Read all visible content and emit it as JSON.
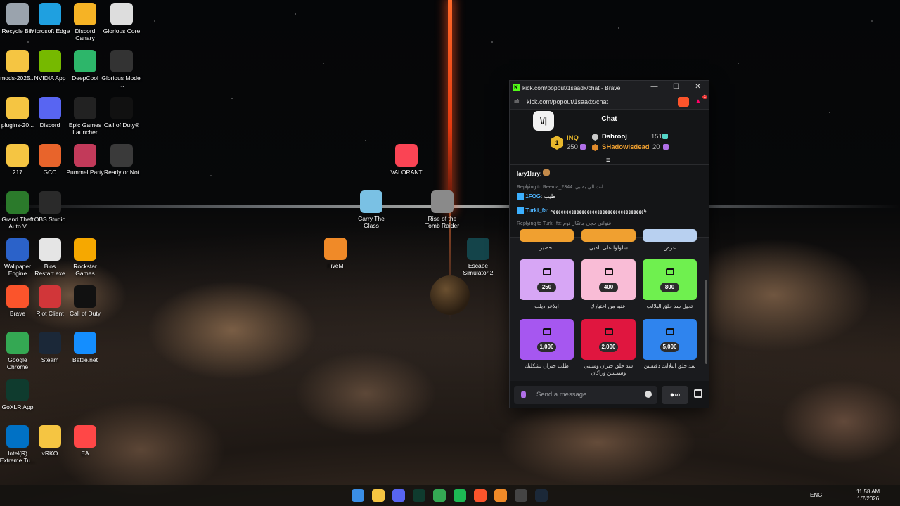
{
  "desktop_icons": [
    {
      "label": "Recycle Bin",
      "icon": "recycle-bin-icon",
      "color": "#9aa3ad"
    },
    {
      "label": "Microsoft Edge",
      "icon": "edge-icon",
      "color": "#1fa0e0"
    },
    {
      "label": "Discord Canary",
      "icon": "discord-canary-icon",
      "color": "#f6b325"
    },
    {
      "label": "Glorious Core",
      "icon": "glorious-core-icon",
      "color": "#dddddd"
    },
    {
      "label": "mods-2025...",
      "icon": "folder-icon",
      "color": "#f5c542"
    },
    {
      "label": "NVIDIA App",
      "icon": "nvidia-icon",
      "color": "#76b900"
    },
    {
      "label": "DeepCool",
      "icon": "deepcool-icon",
      "color": "#2db66a"
    },
    {
      "label": "Glorious Model ...",
      "icon": "mouse-icon",
      "color": "#333333"
    },
    {
      "label": "plugins-20...",
      "icon": "folder-icon",
      "color": "#f5c542"
    },
    {
      "label": "Discord",
      "icon": "discord-icon",
      "color": "#5865f2"
    },
    {
      "label": "Epic Games Launcher",
      "icon": "epic-games-icon",
      "color": "#222222"
    },
    {
      "label": "Call of Duty®",
      "icon": "call-of-duty-icon",
      "color": "#111111"
    },
    {
      "label": "217",
      "icon": "folder-icon",
      "color": "#f5c542"
    },
    {
      "label": "GCC",
      "icon": "gcc-icon",
      "color": "#e8642b"
    },
    {
      "label": "Pummel Party",
      "icon": "pummel-party-icon",
      "color": "#c23a5a"
    },
    {
      "label": "Ready or Not",
      "icon": "ready-or-not-icon",
      "color": "#3a3a3a"
    },
    {
      "label": "Grand Theft Auto V",
      "icon": "gta-icon",
      "color": "#2b7a2b"
    },
    {
      "label": "OBS Studio",
      "icon": "obs-icon",
      "color": "#2a2a2a"
    },
    {
      "label": "Wallpaper Engine",
      "icon": "wallpaper-engine-icon",
      "color": "#2b62c9"
    },
    {
      "label": "Bios Restart.exe",
      "icon": "bios-icon",
      "color": "#e5e5e5"
    },
    {
      "label": "Rockstar Games",
      "icon": "rockstar-icon",
      "color": "#f6a800"
    },
    {
      "label": "Brave",
      "icon": "brave-icon",
      "color": "#fb542b"
    },
    {
      "label": "Riot Client",
      "icon": "riot-icon",
      "color": "#d13639"
    },
    {
      "label": "Call of Duty",
      "icon": "call-of-duty-icon",
      "color": "#111111"
    },
    {
      "label": "Google Chrome",
      "icon": "chrome-icon",
      "color": "#34a853"
    },
    {
      "label": "Steam",
      "icon": "steam-icon",
      "color": "#1b2838"
    },
    {
      "label": "Battle.net",
      "icon": "battlenet-icon",
      "color": "#148eff"
    },
    {
      "label": "GoXLR App",
      "icon": "goxlr-icon",
      "color": "#0f3b2e"
    },
    {
      "label": "Intel(R) Extreme Tu...",
      "icon": "intel-icon",
      "color": "#0071c5"
    },
    {
      "label": "vRKO",
      "icon": "folder-icon",
      "color": "#f5c542"
    },
    {
      "label": "EA",
      "icon": "ea-icon",
      "color": "#ff4747"
    },
    {
      "label": "VALORANT",
      "icon": "valorant-icon",
      "color": "#fa4454"
    },
    {
      "label": "Carry The Glass",
      "icon": "carry-the-glass-icon",
      "color": "#7ac1e4"
    },
    {
      "label": "Rise of the Tomb Raider",
      "icon": "tomb-raider-icon",
      "color": "#8a8a8a"
    },
    {
      "label": "FiveM",
      "icon": "fivem-icon",
      "color": "#f08a28"
    },
    {
      "label": "Escape Simulator 2",
      "icon": "escape-simulator-icon",
      "color": "#14444a"
    }
  ],
  "browser": {
    "title": "kick.com/popout/1saadx/chat - Brave",
    "url": "kick.com/popout/1saadx/chat",
    "shield_badge": "",
    "notif_badge": "1"
  },
  "chat": {
    "header": "Chat",
    "badge": "\\/‾│",
    "leaderboard": {
      "first": {
        "rank": "1",
        "name": "INQ",
        "points": "250"
      },
      "second": [
        {
          "name": "Dahrooj",
          "points": "151"
        },
        {
          "name": "SHadowisdead",
          "points": "20"
        }
      ]
    },
    "messages": [
      {
        "user": "lary1lary",
        "text": "",
        "color": "#e4e4e4"
      },
      {
        "reply": "Replying to Reema_2344: انت الي بقابي"
      },
      {
        "user": "1FOG",
        "text": "طيب",
        "color": "#4fb5ff"
      },
      {
        "user": "Turki_fa",
        "text": "ههههههههههههههههههههههههههههههههههههه",
        "color": "#4fb5ff"
      },
      {
        "reply": "Replying to Turki_fa: غنواني حجي ماتكال توم"
      }
    ],
    "rewards": [
      {
        "label": "تحضير",
        "cost": "",
        "color": "#f0a030"
      },
      {
        "label": "سلولوا على القبي",
        "cost": "",
        "color": "#f0a030"
      },
      {
        "label": "عرص",
        "cost": "",
        "color": "#b8d0f0"
      },
      {
        "label": "ابلاعر ديلب",
        "cost": "250",
        "color": "#d7a6f5"
      },
      {
        "label": "اعتبه من اختيارك",
        "cost": "400",
        "color": "#f9bcd6"
      },
      {
        "label": "تحيل سد حلق البلالت",
        "cost": "800",
        "color": "#6ff04f"
      },
      {
        "label": "طلب جيران بشكلتك",
        "cost": "1,000",
        "color": "#a657f0"
      },
      {
        "label": "سد حلق جيران وسليي وسمسن وزاكان",
        "cost": "2,000",
        "color": "#e0163f"
      },
      {
        "label": "سد حلق البلالت دقيقتين",
        "cost": "5,000",
        "color": "#2f84ee"
      }
    ],
    "input_placeholder": "Send a message"
  },
  "taskbar": {
    "apps": [
      "windows-icon",
      "file-explorer-icon",
      "discord-icon",
      "goxlr-icon",
      "chrome-icon",
      "spotify-icon",
      "brave-icon",
      "fivem-icon",
      "obs-icon",
      "steam-icon"
    ],
    "lang": "ENG",
    "time": "11:58 AM",
    "date": "1/7/2026"
  }
}
